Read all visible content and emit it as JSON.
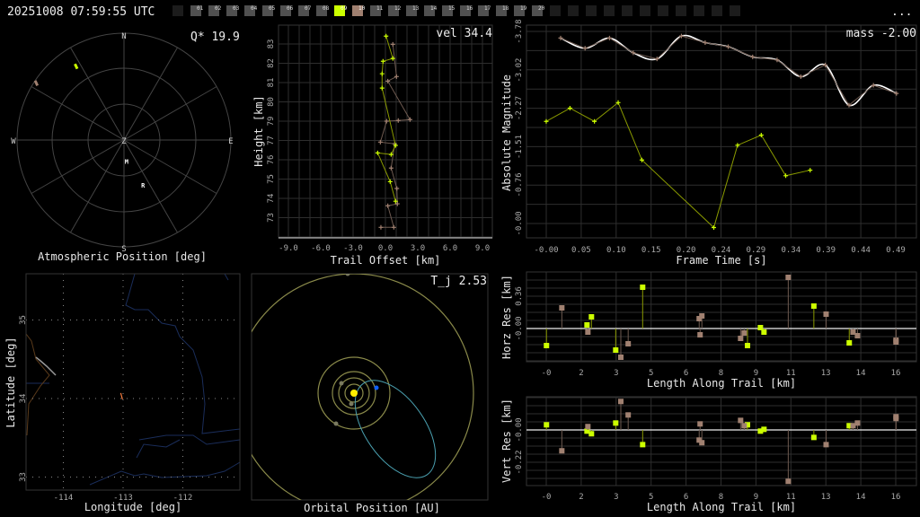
{
  "header": {
    "timestamp": "20251008 07:59:55 UTC",
    "menu_label": "...",
    "frames": {
      "total_slots": 32,
      "labels": [
        "01",
        "02",
        "03",
        "04",
        "05",
        "06",
        "07",
        "08",
        "09",
        "10",
        "11",
        "12",
        "13",
        "14",
        "15",
        "16",
        "17",
        "18",
        "19",
        "20"
      ],
      "selected": [
        {
          "label": "09",
          "color": "#ccff00"
        },
        {
          "label": "10",
          "color": "#a08070"
        }
      ]
    }
  },
  "colors": {
    "camera_1": "#ccff00",
    "camera_2": "#a08070",
    "fit": "#ffffff",
    "orbit": "#4aa0b0",
    "planet_orbit": "#8a8a4a",
    "earth": "#1060ff",
    "sun": "#ffee00",
    "rivers": "#1a2d5a"
  },
  "chart_data": [
    {
      "type": "scatter",
      "panel": "polar",
      "title": "Atmospheric Position [deg]",
      "stat": "Q* 19.9",
      "compass": {
        "n": "N",
        "s": "S",
        "e": "E",
        "w": "W",
        "z": "Z"
      },
      "markers": {
        "m": "M",
        "r": "R"
      },
      "series": [
        {
          "color": "#ccff00",
          "azimuth_deg": 327,
          "zenith_deg": 74
        },
        {
          "color": "#a08070",
          "azimuth_deg": 303,
          "zenith_deg": 88
        }
      ],
      "marker_positions": [
        {
          "label": "M",
          "azimuth_deg": 173,
          "zenith_deg": 18
        },
        {
          "label": "R",
          "azimuth_deg": 157,
          "zenith_deg": 41
        }
      ]
    },
    {
      "type": "line",
      "panel": "trail",
      "xlabel": "Trail Offset [km]",
      "ylabel": "Height [km]",
      "stat": "vel 34.4",
      "xlim": [
        -9.9,
        9.9
      ],
      "xticks": [
        "-9.0",
        "-6.0",
        "-3.0",
        "0.0",
        "3.0",
        "6.0",
        "9.0"
      ],
      "yticks": [
        "83",
        "82",
        "81",
        "80",
        "79",
        "77",
        "76",
        "75",
        "74",
        "73"
      ],
      "series": [
        {
          "color": "#ccff00",
          "offset": [
            0.06,
            0.69,
            -0.22,
            -0.31,
            -0.31,
            0.94,
            0.53,
            -0.72,
            0.44,
            0.94
          ],
          "height": [
            83.45,
            82.17,
            82.01,
            81.29,
            80.47,
            77.18,
            76.66,
            76.75,
            75.1,
            73.98
          ]
        },
        {
          "color": "#a08070",
          "offset": [
            0.69,
            1.03,
            0.22,
            2.28,
            1.19,
            0.11,
            -0.47,
            0.86,
            0.53,
            1.06,
            1.11,
            0.22,
            0.78,
            -0.42
          ],
          "height": [
            82.98,
            81.13,
            80.87,
            78.66,
            78.61,
            78.57,
            77.37,
            77.27,
            75.88,
            74.71,
            73.83,
            73.72,
            72.48,
            72.48
          ]
        }
      ]
    },
    {
      "type": "line",
      "panel": "magnitude",
      "xlabel": "Frame Time [s]",
      "ylabel": "Absolute Magnitude",
      "stat": "mass -2.00",
      "xticks": [
        "-0.00",
        "0.05",
        "0.10",
        "0.15",
        "0.20",
        "0.24",
        "0.29",
        "0.34",
        "0.39",
        "0.44",
        "0.49"
      ],
      "yticks": [
        {
          "value": -3.78,
          "label": "-3.78"
        },
        {
          "value": -3.02,
          "label": "-3.02"
        },
        {
          "value": -2.27,
          "label": "-2.27"
        },
        {
          "value": -1.51,
          "label": "-1.51"
        },
        {
          "value": -0.76,
          "label": "-0.76"
        },
        {
          "value": 0,
          "label": "-0.00"
        }
      ],
      "y_inverted": true,
      "series": [
        {
          "color": "#ccff00",
          "t": [
            0.0,
            0.033,
            0.067,
            0.1,
            0.133,
            0.233,
            0.266,
            0.299,
            0.333,
            0.367
          ],
          "mag": [
            -2.01,
            -2.27,
            -2.01,
            -2.38,
            -1.25,
            0.08,
            -1.54,
            -1.74,
            -0.94,
            -1.05
          ]
        },
        {
          "color": "#a08070",
          "smooth_fit": true,
          "t": [
            0.02,
            0.054,
            0.088,
            0.121,
            0.154,
            0.188,
            0.221,
            0.253,
            0.287,
            0.321,
            0.354,
            0.388,
            0.421,
            0.455,
            0.487
          ],
          "mag": [
            -3.65,
            -3.45,
            -3.65,
            -3.36,
            -3.24,
            -3.69,
            -3.56,
            -3.48,
            -3.28,
            -3.22,
            -2.89,
            -3.12,
            -2.33,
            -2.72,
            -2.56
          ]
        }
      ]
    },
    {
      "type": "scatter",
      "panel": "map",
      "xlabel": "Longitude [deg]",
      "ylabel": "Latitude [deg]",
      "xticks": [
        {
          "value": -114,
          "label": "-114"
        },
        {
          "value": -113,
          "label": "-113"
        },
        {
          "value": -112,
          "label": "-112"
        }
      ],
      "yticks": [
        {
          "value": 35,
          "label": "35"
        },
        {
          "value": 34,
          "label": "34"
        },
        {
          "value": 33,
          "label": "33"
        }
      ],
      "trail": {
        "color": "#ff8040",
        "lon": [
          -113.04,
          -113.01
        ],
        "lat": [
          34.07,
          33.99
        ]
      }
    },
    {
      "type": "scatter",
      "panel": "orbit",
      "xlabel": "Orbital Position [AU]",
      "stat": "T_j 2.53"
    },
    {
      "type": "scatter",
      "panel": "horizontal-residuals",
      "xlabel": "Length Along Trail [km]",
      "ylabel": "Horz Res [km]",
      "xticks": [
        "-0",
        "2",
        "3",
        "5",
        "6",
        "8",
        "9",
        "11",
        "13",
        "14",
        "16"
      ],
      "yticks": [
        {
          "value": 0,
          "label": "-0.00"
        },
        {
          "value": 0.36,
          "label": "0.36"
        }
      ],
      "series": [
        {
          "color": "#ccff00",
          "length": [
            0.01,
            1.83,
            2.03,
            3.12,
            4.33,
            9.04,
            9.62,
            9.78,
            12.02,
            13.61
          ],
          "residual": [
            -0.19,
            0.04,
            0.13,
            -0.24,
            0.46,
            -0.19,
            0.01,
            -0.04,
            0.25,
            -0.16
          ]
        },
        {
          "color": "#a08070",
          "length": [
            0.7,
            1.87,
            3.35,
            3.68,
            6.87,
            6.99,
            6.91,
            8.73,
            8.89,
            10.87,
            12.57,
            13.78,
            13.98,
            15.71,
            15.71
          ],
          "residual": [
            0.23,
            -0.04,
            -0.32,
            -0.17,
            0.11,
            0.14,
            -0.07,
            -0.11,
            -0.05,
            0.57,
            0.16,
            -0.04,
            -0.08,
            -0.13,
            -0.15
          ]
        }
      ]
    },
    {
      "type": "scatter",
      "panel": "vertical-residuals",
      "xlabel": "Length Along Trail [km]",
      "ylabel": "Vert Res [km]",
      "xticks": [
        "-0",
        "2",
        "3",
        "5",
        "6",
        "8",
        "9",
        "11",
        "13",
        "14",
        "16"
      ],
      "yticks": [
        {
          "value": 0,
          "label": "-0.00"
        },
        {
          "value": -0.22,
          "label": "-0.22"
        }
      ],
      "series": [
        {
          "color": "#ccff00",
          "length": [
            0.01,
            1.83,
            2.03,
            3.12,
            4.33,
            9.04,
            9.62,
            9.78,
            12.02,
            13.61
          ],
          "residual": [
            0.035,
            -0.008,
            -0.026,
            0.047,
            -0.1,
            0.035,
            -0.008,
            0.004,
            -0.051,
            0.029
          ]
        },
        {
          "color": "#a08070",
          "length": [
            0.7,
            1.87,
            3.35,
            3.68,
            6.87,
            6.99,
            6.91,
            8.73,
            8.89,
            10.87,
            12.57,
            13.78,
            13.98,
            15.71,
            15.71
          ],
          "residual": [
            -0.142,
            0.023,
            0.194,
            0.102,
            -0.069,
            -0.087,
            0.041,
            0.065,
            0.029,
            -0.35,
            -0.1,
            0.029,
            0.047,
            0.09,
            0.078
          ]
        }
      ]
    }
  ]
}
